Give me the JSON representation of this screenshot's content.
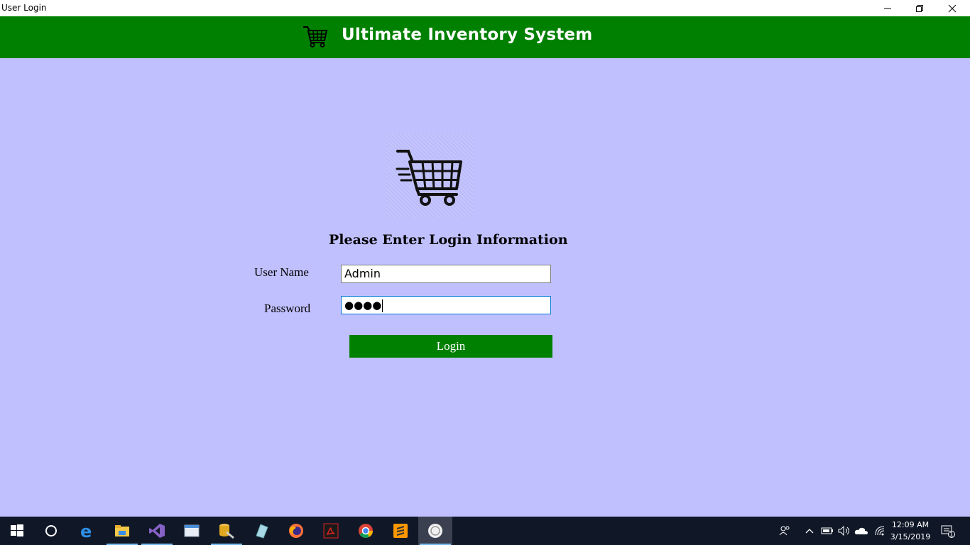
{
  "window": {
    "title": "User Login"
  },
  "header": {
    "app_title": "Ultimate Inventory System"
  },
  "form": {
    "heading": "Please Enter Login Information",
    "username_label": "User Name",
    "username_value": "Admin",
    "password_label": "Password",
    "password_mask": "●●●●",
    "login_label": "Login"
  },
  "taskbar": {
    "apps": [
      "start-icon",
      "cortana-icon",
      "edge-icon",
      "file-explorer-icon",
      "visual-studio-icon",
      "window-icon",
      "database-tool-icon",
      "notes-icon",
      "firefox-icon",
      "acrobat-icon",
      "chrome-icon",
      "sublime-icon",
      "app-icon"
    ],
    "time": "12:09 AM",
    "date": "3/15/2019",
    "notification_count": "1"
  },
  "colors": {
    "header_green": "#008000",
    "background": "#c0c0ff",
    "taskbar": "#101828"
  }
}
